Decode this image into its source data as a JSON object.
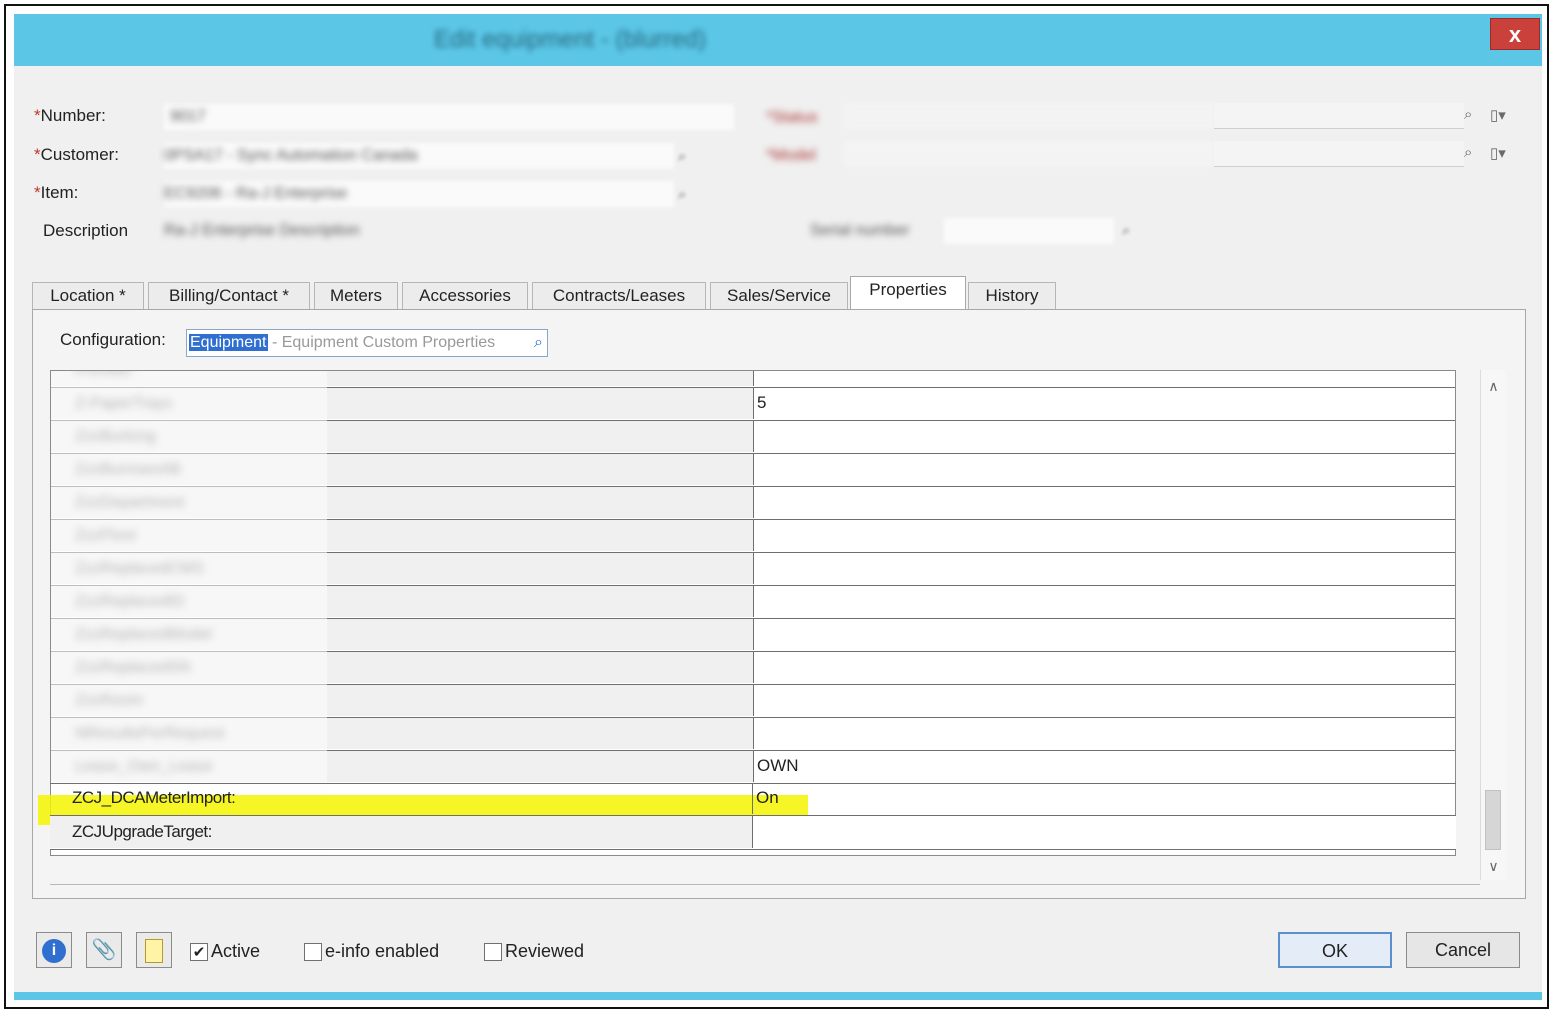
{
  "window": {
    "title": "Edit equipment - (blurred)",
    "close_label": "x"
  },
  "form": {
    "number_label": "Number:",
    "customer_label": "Customer:",
    "item_label": "Item:",
    "description_label": "Description",
    "required_mark": "*"
  },
  "tabs": [
    {
      "label": "Location *"
    },
    {
      "label": "Billing/Contact *"
    },
    {
      "label": "Meters"
    },
    {
      "label": "Accessories"
    },
    {
      "label": "Contracts/Leases"
    },
    {
      "label": "Sales/Service"
    },
    {
      "label": "Properties"
    },
    {
      "label": "History"
    }
  ],
  "properties": {
    "config_label": "Configuration:",
    "config_selected": "Equipment",
    "config_rest": " - Equipment Custom Properties",
    "rows": [
      {
        "name": "",
        "value": "5"
      },
      {
        "name": "",
        "value": ""
      },
      {
        "name": "",
        "value": ""
      },
      {
        "name": "",
        "value": ""
      },
      {
        "name": "",
        "value": ""
      },
      {
        "name": "",
        "value": ""
      },
      {
        "name": "",
        "value": ""
      },
      {
        "name": "",
        "value": ""
      },
      {
        "name": "",
        "value": ""
      },
      {
        "name": "",
        "value": ""
      },
      {
        "name": "",
        "value": ""
      },
      {
        "name": "",
        "value": "OWN"
      },
      {
        "name": "ZCJ_DCAMeterImport:",
        "value": "On"
      },
      {
        "name": "ZCJUpgradeTarget:",
        "value": ""
      }
    ]
  },
  "footer": {
    "active_label": "Active",
    "active_checked": true,
    "einfo_label": "e-info enabled",
    "einfo_checked": false,
    "reviewed_label": "Reviewed",
    "reviewed_checked": false,
    "ok_label": "OK",
    "cancel_label": "Cancel"
  },
  "colors": {
    "titlebar": "#5bc6e6",
    "highlight": "#f5f500",
    "close": "#c9413a"
  }
}
